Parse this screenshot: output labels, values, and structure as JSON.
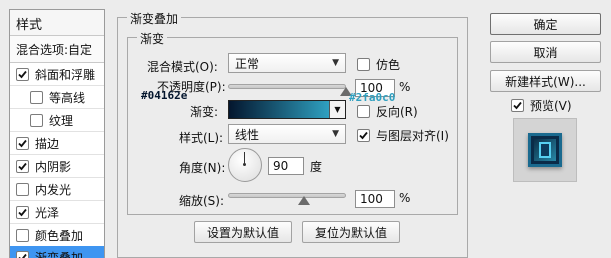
{
  "style_list": {
    "title": "样式",
    "blend_options": "混合选项:自定",
    "items": [
      {
        "label": "斜面和浮雕",
        "checked": true
      },
      {
        "label": "等高线",
        "checked": false
      },
      {
        "label": "纹理",
        "checked": false
      },
      {
        "label": "描边",
        "checked": true
      },
      {
        "label": "内阴影",
        "checked": true
      },
      {
        "label": "内发光",
        "checked": false
      },
      {
        "label": "光泽",
        "checked": true
      },
      {
        "label": "颜色叠加",
        "checked": false
      },
      {
        "label": "渐变叠加",
        "checked": true
      }
    ]
  },
  "panel": {
    "outer_title": "渐变叠加",
    "inner_title": "渐变",
    "blend_mode_label": "混合模式(O):",
    "blend_mode_value": "正常",
    "dither_label": "仿色",
    "opacity_label": "不透明度(P):",
    "opacity_value": "100",
    "opacity_unit": "%",
    "opacity_percent": 100,
    "gradient_label": "渐变:",
    "reverse_label": "反向(R)",
    "style_label": "样式(L):",
    "style_value": "线性",
    "align_label": "与图层对齐(I)",
    "angle_label": "角度(N):",
    "angle_value": "90",
    "angle_unit": "度",
    "scale_label": "缩放(S):",
    "scale_value": "100",
    "scale_unit": "%",
    "scale_percent": 100,
    "default_button": "设置为默认值",
    "reset_button": "复位为默认值"
  },
  "annotations": {
    "color_start": "#04162e",
    "color_end": "#2fa0c0"
  },
  "right": {
    "ok": "确定",
    "cancel": "取消",
    "new_style": "新建样式(W)...",
    "preview_label": "预览(V)"
  },
  "colors": {
    "selection": "#3e95f1",
    "gradient_start": "#04162e",
    "gradient_end": "#2fa0c0"
  }
}
